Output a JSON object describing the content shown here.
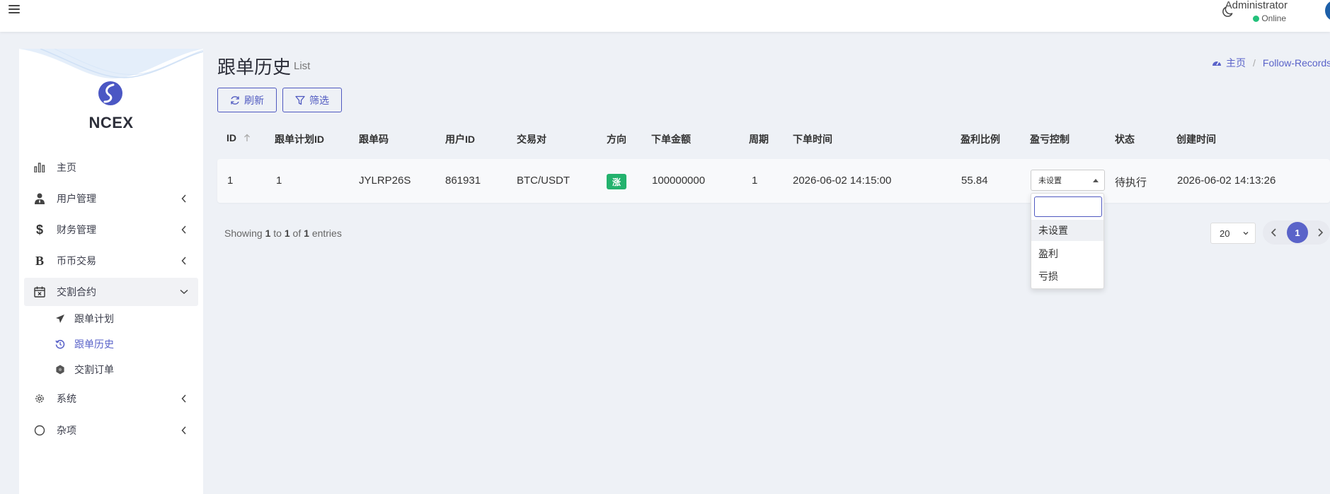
{
  "navbar": {
    "user_name": "Administrator",
    "user_status": "Online"
  },
  "sidebar": {
    "brand": "NCEX",
    "items": [
      {
        "label": "主页",
        "icon": "bar-chart-icon",
        "has_children": false
      },
      {
        "label": "用户管理",
        "icon": "user-tie-icon",
        "has_children": true
      },
      {
        "label": "财务管理",
        "icon": "dollar-icon",
        "has_children": true
      },
      {
        "label": "币币交易",
        "icon": "bitcoin-icon",
        "has_children": true
      },
      {
        "label": "交割合约",
        "icon": "calendar-x-icon",
        "has_children": true,
        "expanded": true
      },
      {
        "label": "系统",
        "icon": "gear-icon",
        "has_children": true
      },
      {
        "label": "杂项",
        "icon": "circle-icon",
        "has_children": true
      }
    ],
    "sub_items": [
      {
        "label": "跟单计划",
        "icon": "plane-icon"
      },
      {
        "label": "跟单历史",
        "icon": "history-icon",
        "current": true
      },
      {
        "label": "交割订单",
        "icon": "hexagon-icon"
      }
    ]
  },
  "page": {
    "title": "跟单历史",
    "subtitle": "List",
    "breadcrumb": {
      "home": "主页",
      "current": "Follow-Records"
    }
  },
  "toolbar": {
    "refresh_label": "刷新",
    "filter_label": "筛选"
  },
  "table": {
    "columns": [
      "ID",
      "跟单计划ID",
      "跟单码",
      "用户ID",
      "交易对",
      "方向",
      "下单金额",
      "周期",
      "下单时间",
      "盈利比例",
      "盈亏控制",
      "状态",
      "创建时间"
    ],
    "rows": [
      {
        "id": "1",
        "plan_id": "1",
        "code": "JYLRP26S",
        "user_id": "861931",
        "pair": "BTC/USDT",
        "direction": "涨",
        "amount": "100000000",
        "period": "1",
        "order_time": "2026-06-02 14:15:00",
        "profit_ratio": "55.84",
        "pl_control": "未设置",
        "status": "待执行",
        "created_at": "2026-06-02 14:13:26"
      }
    ],
    "pl_options": [
      "未设置",
      "盈利",
      "亏损"
    ],
    "search_value": ""
  },
  "footer": {
    "showing_prefix": "Showing",
    "from": "1",
    "to_word": "to",
    "to": "1",
    "of_word": "of",
    "total": "1",
    "entries_word": "entries",
    "page_size": "20",
    "current_page": "1"
  },
  "colors": {
    "accent": "#5a63c9",
    "success": "#23b26d",
    "online": "#23c17b"
  }
}
